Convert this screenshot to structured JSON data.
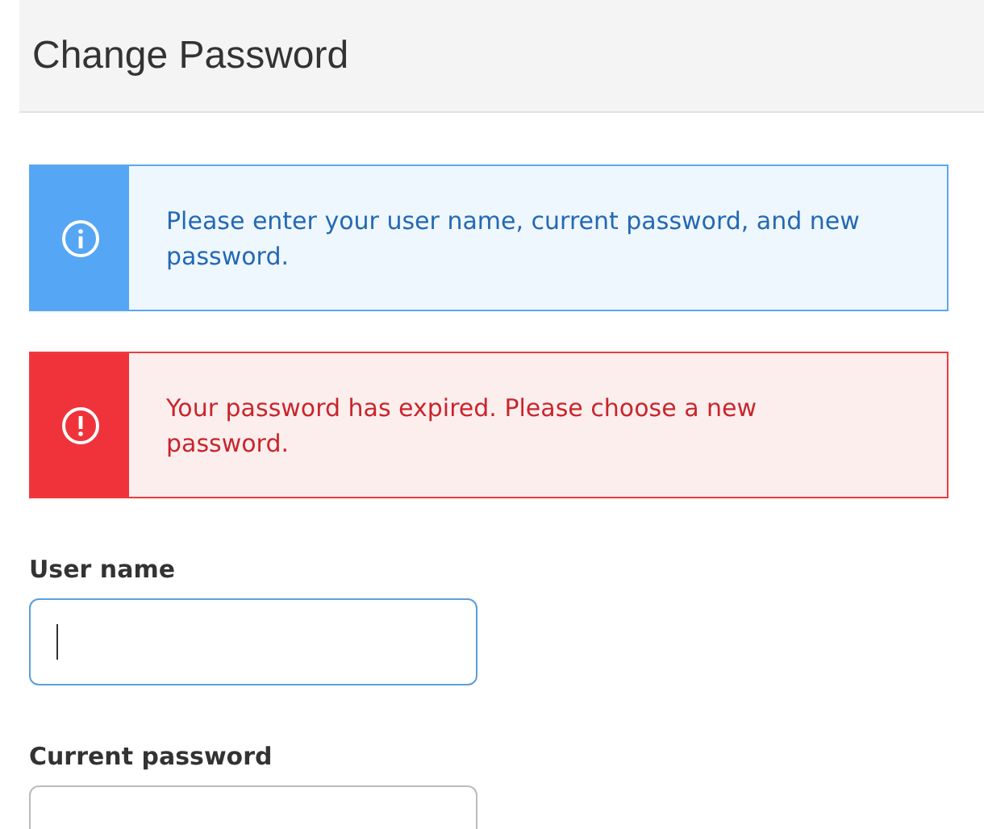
{
  "header": {
    "title": "Change Password"
  },
  "alerts": [
    {
      "kind": "info",
      "text": "Please enter your user name, current password, and new password."
    },
    {
      "kind": "error",
      "text": "Your password has expired. Please choose a new password."
    }
  ],
  "fields": [
    {
      "label": "User name",
      "focused": true
    },
    {
      "label": "Current password",
      "focused": false
    }
  ]
}
